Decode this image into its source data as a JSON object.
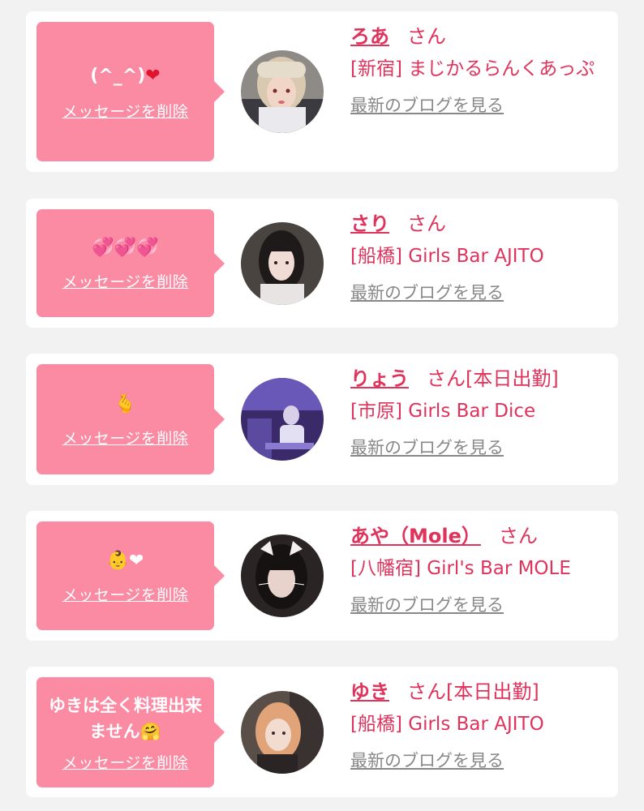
{
  "colors": {
    "bubble": "#fb8aa3",
    "accent": "#e0335c",
    "muted": "#888888",
    "heart": "#e0142c"
  },
  "delete_label": "メッセージを削除",
  "blog_label": "最新のブログを見る",
  "honorific": "さん",
  "cards": [
    {
      "message_text": "(^_^)",
      "message_emoji": "❤",
      "name": "ろあ",
      "working": "",
      "area": "[新宿]",
      "shop": " まじかるらんくあっぷ",
      "avatar": "photo-woman-light-hair"
    },
    {
      "message_text": "",
      "message_emoji": "💞💞💞",
      "name": "さり",
      "working": "",
      "area": "[船橋]",
      "shop": " Girls Bar AJITO",
      "avatar": "photo-woman-dark-hair"
    },
    {
      "message_text": "",
      "message_emoji": "🫰",
      "name": "りょう",
      "working": "[本日出勤]",
      "area": "[市原]",
      "shop": " Girls Bar Dice",
      "avatar": "photo-bar-interior-purple"
    },
    {
      "message_text": "",
      "message_emoji": "👶❤",
      "name": "あや（Mole）",
      "working": "",
      "area": "[八幡宿]",
      "shop": " Girl's Bar MOLE",
      "avatar": "photo-woman-cat-ears"
    },
    {
      "message_text": "ゆきは全く料理出来ません",
      "message_emoji": "🤗",
      "name": "ゆき",
      "working": "[本日出勤]",
      "area": "[船橋]",
      "shop": " Girls Bar AJITO",
      "avatar": "photo-woman-orange-hair"
    }
  ]
}
